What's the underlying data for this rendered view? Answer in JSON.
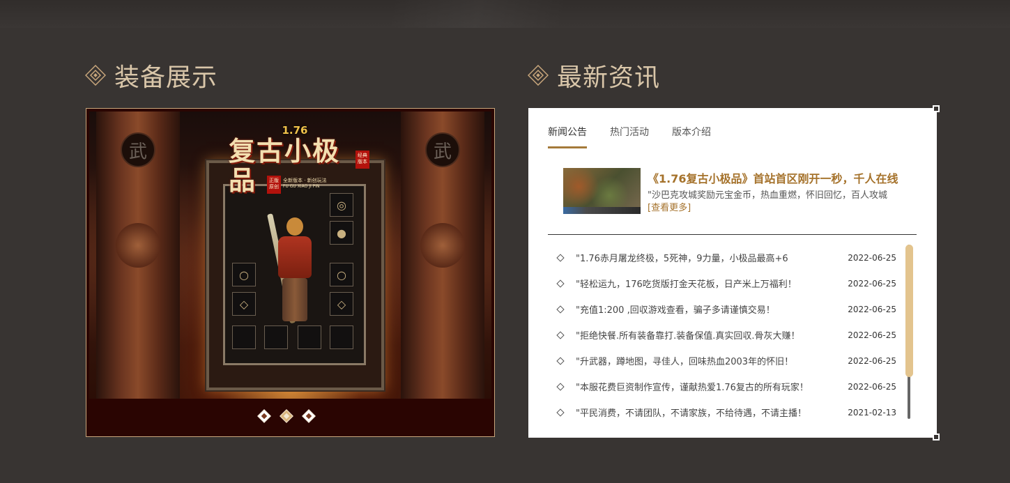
{
  "left_section": {
    "title": "装备展示",
    "game": {
      "version": "1.76",
      "name": "复古小极品",
      "seal_left": "正版原创",
      "seal_right": "经典版本",
      "tagline": "全新版本 · 新创玩法",
      "pinyin": "FU GU XIAO JI PIN",
      "pillar_glyph": "武"
    },
    "carousel_slides": 3,
    "active_slide": 2
  },
  "right_section": {
    "title": "最新资讯",
    "tabs": [
      {
        "label": "新闻公告",
        "active": true
      },
      {
        "label": "热门活动",
        "active": false
      },
      {
        "label": "版本介绍",
        "active": false
      }
    ],
    "featured": {
      "title": "《1.76复古小极品》首站首区刚开一秒，千人在线",
      "description": "\"沙巴克攻城奖励元宝金币，热血重燃，怀旧回忆，百人攻城",
      "more_label": "[查看更多]"
    },
    "news": [
      {
        "title": "\"1.76赤月屠龙终极，5死神，9力量，小极品最高+6",
        "date": "2022-06-25"
      },
      {
        "title": "\"轻松运九，176吃货版打金天花板，日产米上万福利！",
        "date": "2022-06-25"
      },
      {
        "title": "\"充值1:200 ,回収游戏查看，骗子多请谨慎交易！",
        "date": "2022-06-25"
      },
      {
        "title": "\"拒绝快餐.所有装备靠打.装备保值.真实回収.骨灰大赚！",
        "date": "2022-06-25"
      },
      {
        "title": "\"升武器，蹲地图，寻佳人，回味热血2003年的怀旧！",
        "date": "2022-06-25"
      },
      {
        "title": "\"本服花费巨资制作宣传，谨献热爱1.76复古的所有玩家！",
        "date": "2022-06-25"
      },
      {
        "title": "\"平民消费，不请团队，不请家族，不给待遇，不请主播！",
        "date": "2021-02-13"
      }
    ]
  },
  "colors": {
    "background": "#383432",
    "heading": "#d9c6a9",
    "accent_gold": "#a5722b",
    "scroll_thumb": "#e3c48e"
  }
}
